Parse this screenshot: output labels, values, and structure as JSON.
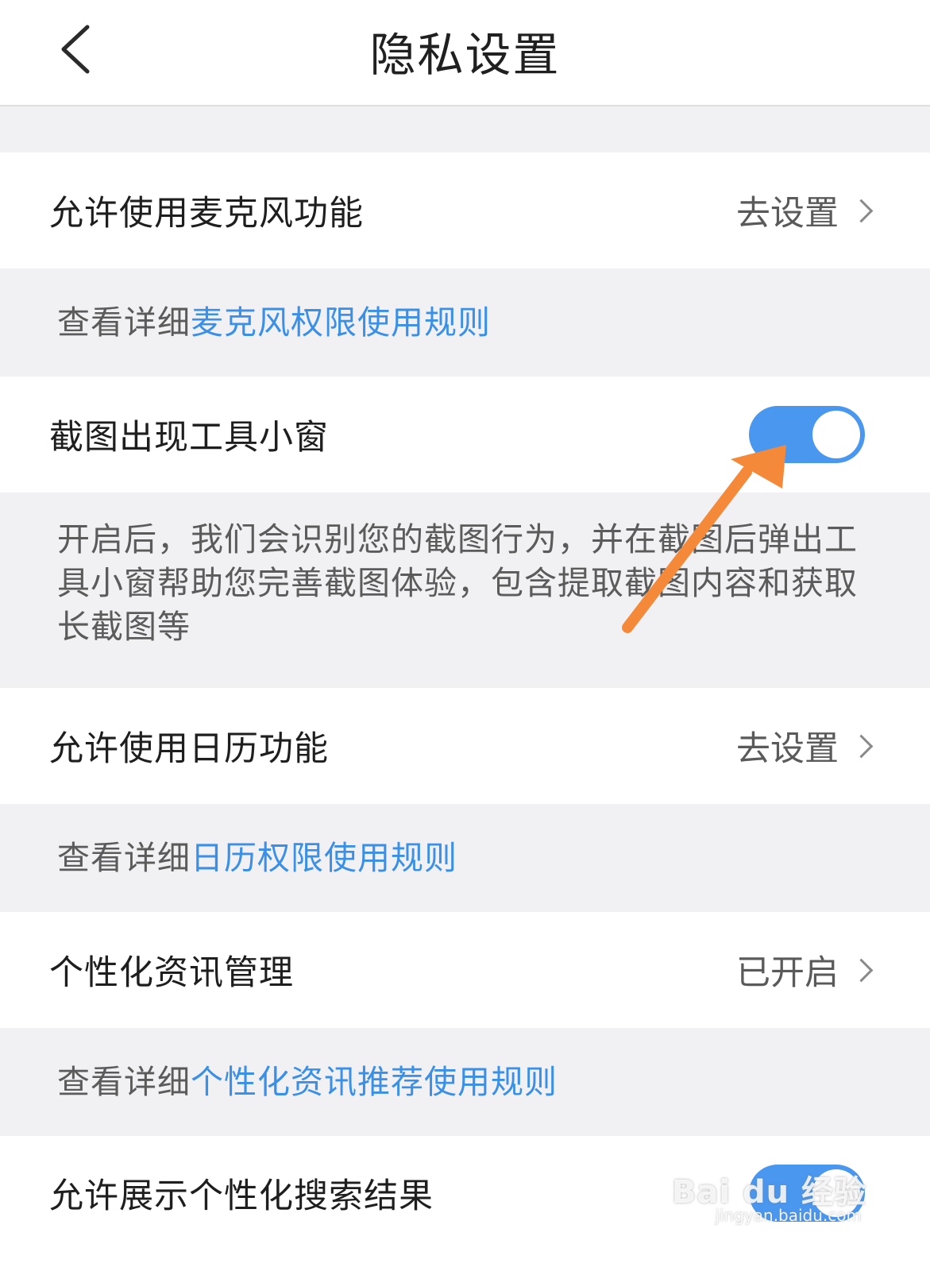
{
  "header": {
    "title": "隐私设置"
  },
  "rows": {
    "microphone": {
      "label": "允许使用麦克风功能",
      "action": "去设置"
    },
    "screenshot_tool": {
      "label": "截图出现工具小窗",
      "toggle_on": true
    },
    "calendar": {
      "label": "允许使用日历功能",
      "action": "去设置"
    },
    "personalized_news": {
      "label": "个性化资讯管理",
      "action": "已开启"
    },
    "personalized_search": {
      "label": "允许展示个性化搜索结果",
      "toggle_on": true
    }
  },
  "notes": {
    "microphone": {
      "prefix": "查看详细",
      "link": "麦克风权限使用规则"
    },
    "screenshot_desc": "开启后，我们会识别您的截图行为，并在截图后弹出工具小窗帮助您完善截图体验，包含提取截图内容和获取长截图等",
    "calendar": {
      "prefix": "查看详细",
      "link": "日历权限使用规则"
    },
    "personalized_news": {
      "prefix": "查看详细",
      "link": "个性化资讯推荐使用规则"
    }
  },
  "watermark": {
    "text": "Bai du 经验",
    "sub": "jingyan.baidu.com"
  },
  "colors": {
    "accent": "#4a97f0",
    "link": "#3a8fe6",
    "annotation_arrow": "#f5893a",
    "background": "#f1f1f3"
  },
  "icons": {
    "back": "back-chevron-icon",
    "row_chevron": "chevron-right-icon",
    "annotation": "orange-arrow-annotation"
  }
}
